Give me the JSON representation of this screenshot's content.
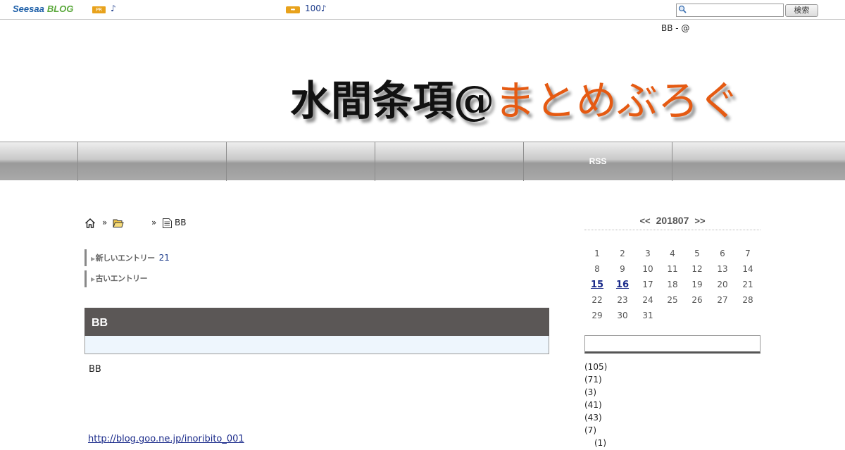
{
  "topbar": {
    "logo_seesaa": "Seesaa",
    "logo_blog": "BLOG",
    "pr_badge": "PR",
    "pr_note": "♪",
    "promo_arrow": "➡",
    "promo_text": "100♪",
    "search_placeholder": "",
    "search_button": "検索"
  },
  "tagline": "BB - @",
  "banner": {
    "title_kanji": "水間条項@",
    "title_kana": "まとめぶろぐ"
  },
  "nav": {
    "items": [
      "",
      "",
      "",
      "",
      "RSS",
      ""
    ]
  },
  "breadcrumb": {
    "sep": "»",
    "current": "BB"
  },
  "entry_nav": {
    "newer_label": "新しいエントリー",
    "newer_value": "21",
    "older_label": "古いエントリー"
  },
  "post": {
    "title": "BB",
    "body": "BB",
    "link": "http://blog.goo.ne.jp/inoribito_001"
  },
  "calendar": {
    "prev": "<<",
    "month": "201807",
    "next": ">>",
    "weeks": [
      [
        "1",
        "2",
        "3",
        "4",
        "5",
        "6",
        "7"
      ],
      [
        "8",
        "9",
        "10",
        "11",
        "12",
        "13",
        "14"
      ],
      [
        "15",
        "16",
        "17",
        "18",
        "19",
        "20",
        "21"
      ],
      [
        "22",
        "23",
        "24",
        "25",
        "26",
        "27",
        "28"
      ],
      [
        "29",
        "30",
        "31"
      ]
    ],
    "linked_days": [
      "15",
      "16"
    ]
  },
  "categories": [
    "(105)",
    "(71)",
    "(3)",
    "(41)",
    "(43)",
    "(7)",
    "(1)"
  ],
  "colors": {
    "brand_blue": "#1d5fa8",
    "brand_green": "#5aa83b",
    "accent_orange": "#e55a12",
    "post_header": "#5b5756",
    "link": "#1a2a8a"
  }
}
